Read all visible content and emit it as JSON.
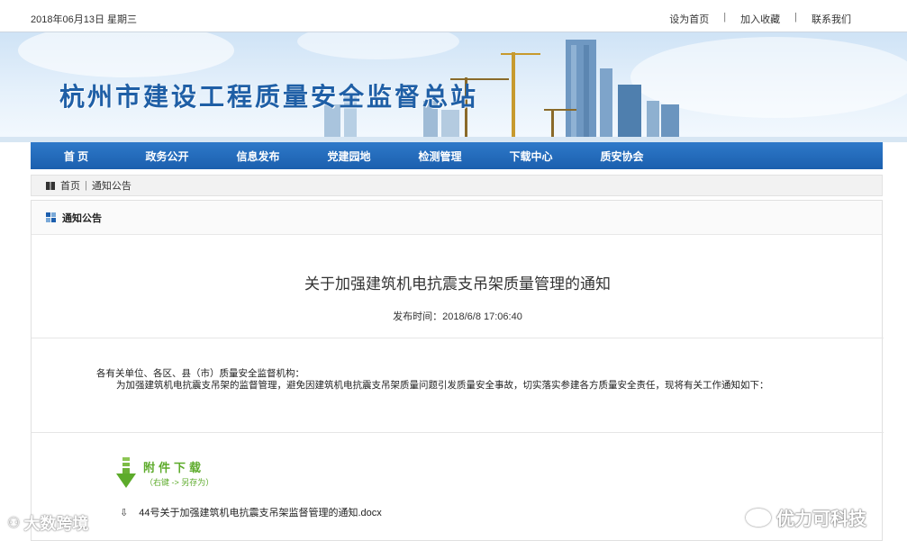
{
  "topbar": {
    "date": "2018年06月13日 星期三",
    "links": [
      "设为首页",
      "加入收藏",
      "联系我们"
    ],
    "separator": "|"
  },
  "banner": {
    "site_title": "杭州市建设工程质量安全监督总站"
  },
  "nav": {
    "items": [
      "首 页",
      "政务公开",
      "信息发布",
      "党建园地",
      "检测管理",
      "下载中心",
      "质安协会"
    ]
  },
  "breadcrumb": {
    "home": "首页",
    "separator": "|",
    "current": "通知公告"
  },
  "panel": {
    "heading": "通知公告"
  },
  "article": {
    "title": "关于加强建筑机电抗震支吊架质量管理的通知",
    "published": "发布时间：2018/6/8 17:06:40",
    "salutation": "各有关单位、各区、县（市）质量安全监督机构：",
    "paragraph": "为加强建筑机电抗震支吊架的监督管理，避免因建筑机电抗震支吊架质量问题引发质量安全事故，切实落实参建各方质量安全责任，现将有关工作通知如下："
  },
  "attachments": {
    "title": "附件下载",
    "hint": "（右键 -> 另存为）",
    "files": [
      "44号关于加强建筑机电抗震支吊架监督管理的通知.docx"
    ]
  },
  "watermarks": {
    "left": "大数跨境",
    "right": "优力可科技"
  },
  "colors": {
    "nav_blue": "#1b5fae",
    "title_blue": "#1f5fa6",
    "attach_green": "#5dab2b"
  }
}
